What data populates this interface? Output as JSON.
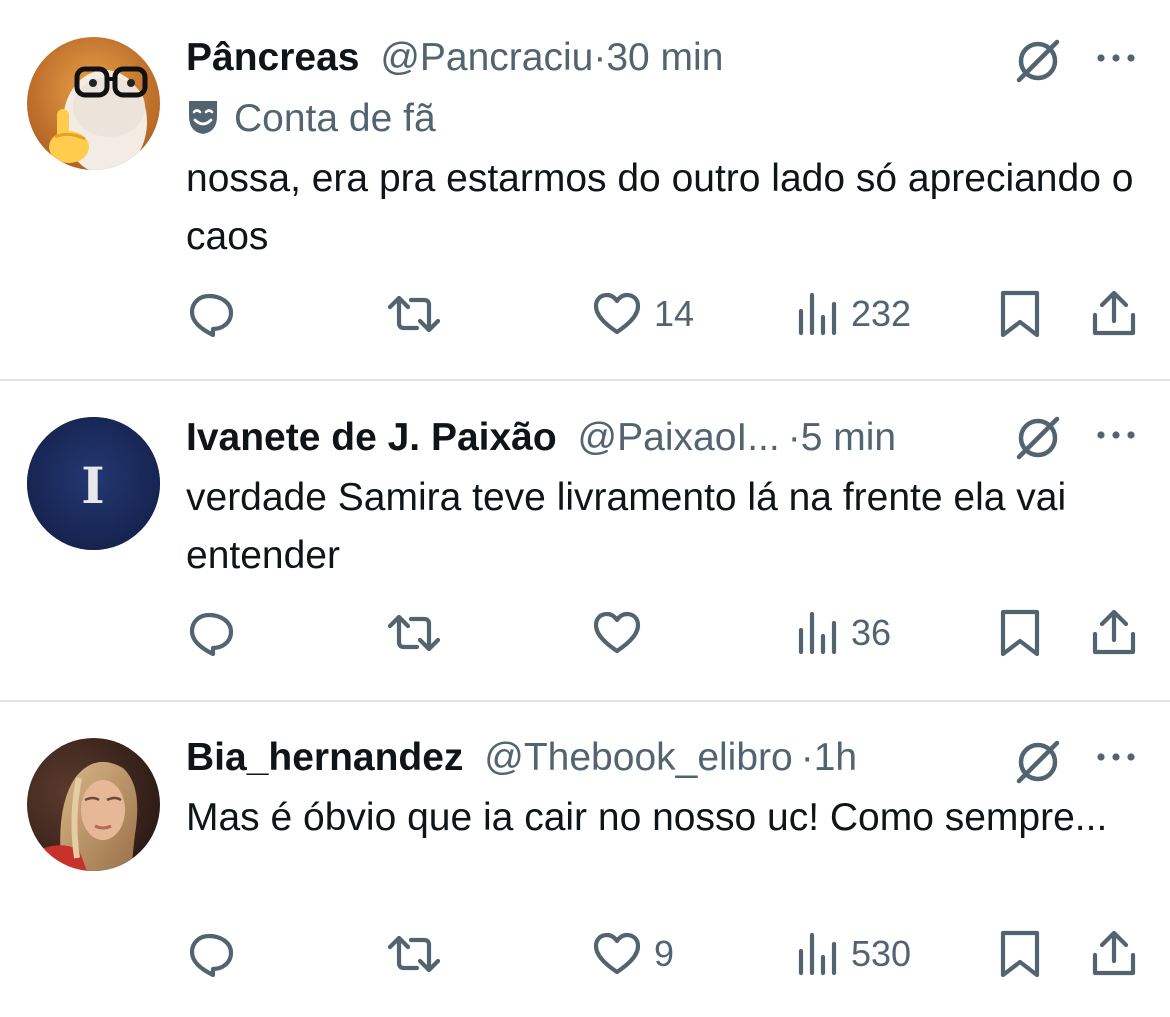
{
  "tweets": [
    {
      "author_name": "Pâncreas",
      "handle": "@Pancraciu",
      "separator": "·",
      "time": "30 min",
      "badge": "Conta de fã",
      "text": "nossa, era pra estarmos do outro lado só apreciando o caos",
      "avatar": "emoji-finger-glasses-avatar",
      "likes": "14",
      "views": "232"
    },
    {
      "author_name": "Ivanete de J. Paixão",
      "handle": "@PaixaoI...",
      "separator": "·",
      "time": "5 min",
      "avatar_letter": "I",
      "text": "verdade Samira teve livramento lá na frente ela vai entender",
      "likes": "",
      "views": "36"
    },
    {
      "author_name": "Bia_hernandez",
      "handle": "@Thebook_elibro",
      "separator": "·",
      "time": "1h",
      "text": "Mas é óbvio que ia cair no nosso uc! Como sempre...",
      "avatar": "woman-photo-avatar",
      "likes": "9",
      "views": "530"
    }
  ],
  "icons": {
    "reply": "reply-icon",
    "retweet": "retweet-icon",
    "like": "heart-icon",
    "views": "views-icon",
    "bookmark": "bookmark-icon",
    "share": "share-icon",
    "grok": "grok-icon",
    "more": "more-icon",
    "fan": "fan-account-mask-icon"
  },
  "colors": {
    "text": "#0f1419",
    "secondary": "#536471",
    "divider": "#dfe3e6",
    "avatar_navy": "#1b2a5c"
  }
}
